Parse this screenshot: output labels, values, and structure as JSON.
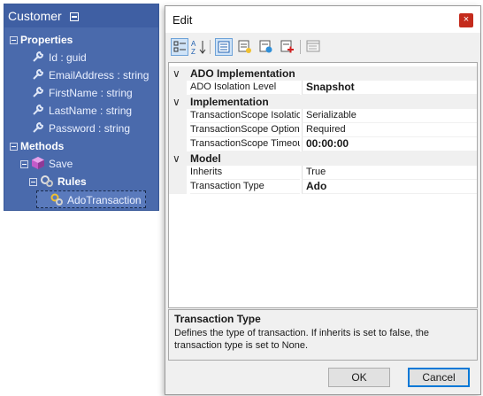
{
  "entity": {
    "title": "Customer",
    "properties_label": "Properties",
    "properties": [
      "Id : guid",
      "EmailAddress : string",
      "FirstName : string",
      "LastName : string",
      "Password : string"
    ],
    "methods_label": "Methods",
    "method": "Save",
    "rules_label": "Rules",
    "rule": "AdoTransaction"
  },
  "dialog": {
    "title": "Edit",
    "close_icon": "×",
    "toolbar": [
      "categorized-icon",
      "alphabetical-icon",
      "properties-icon",
      "events-icon",
      "add-icon",
      "remove-icon",
      "property-pages-icon"
    ],
    "categories": [
      {
        "label": "ADO Implementation",
        "rows": [
          {
            "name": "ADO Isolation Level",
            "value": "Snapshot",
            "bold": true
          }
        ]
      },
      {
        "label": "Implementation",
        "rows": [
          {
            "name": "TransactionScope Isolatio",
            "value": "Serializable",
            "bold": false
          },
          {
            "name": "TransactionScope Option",
            "value": "Required",
            "bold": false
          },
          {
            "name": "TransactionScope Timeou",
            "value": "00:00:00",
            "bold": true
          }
        ]
      },
      {
        "label": "Model",
        "rows": [
          {
            "name": "Inherits",
            "value": "True",
            "bold": false
          },
          {
            "name": "Transaction Type",
            "value": "Ado",
            "bold": true
          }
        ]
      }
    ],
    "description": {
      "title": "Transaction Type",
      "text": "Defines the type of transaction. If inherits is set to false, the transaction type is set to None."
    },
    "ok_label": "OK",
    "cancel_label": "Cancel"
  }
}
